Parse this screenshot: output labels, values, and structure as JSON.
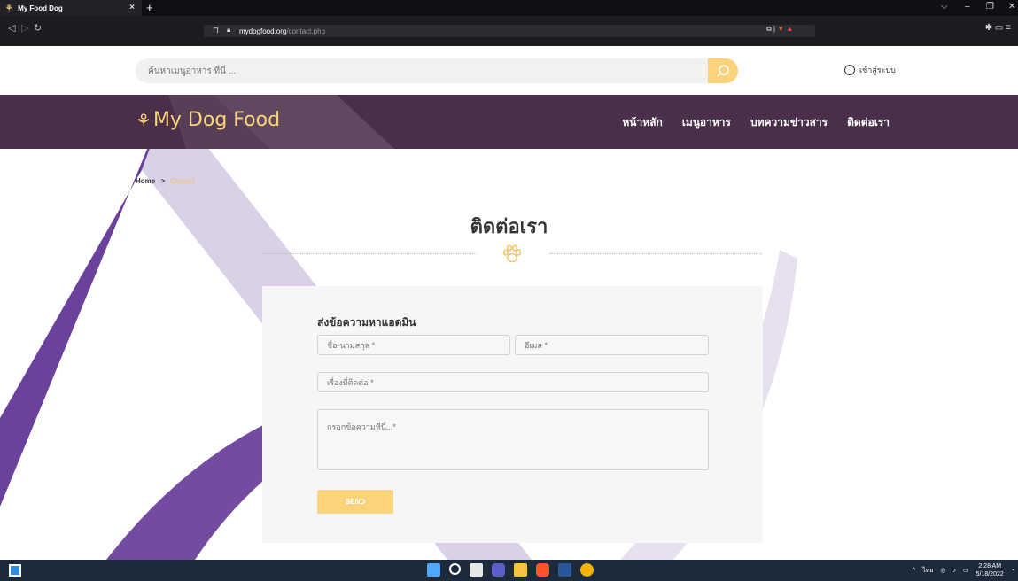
{
  "browser": {
    "tab_title": "My Food Dog",
    "tab_close": "×",
    "new_tab": "+",
    "url_host": "mydogfood.org",
    "url_path": "/contact.php",
    "window_controls": [
      "⌵",
      "–",
      "❐",
      "✕"
    ]
  },
  "search": {
    "placeholder": "ค้นหาเมนูอาหาร ที่นี่ ..."
  },
  "login_label": "เข้าสู่ระบบ",
  "brand": {
    "name": "My Dog Food",
    "color": "#fad37a"
  },
  "nav": {
    "items": [
      "หน้าหลัก",
      "เมนูอาหาร",
      "บทความข่าวสาร",
      "ติดต่อเรา"
    ]
  },
  "breadcrumb": {
    "home": "Home",
    "separator": ">",
    "current": "Contact"
  },
  "page_title": "ติดต่อเรา",
  "form": {
    "title": "ส่งข้อความหาแอดมิน",
    "name_placeholder": "ชื่อ-นามสกุล *",
    "email_placeholder": "อีเมล *",
    "subject_placeholder": "เรื่องที่ติดต่อ *",
    "message_placeholder": "กรอกข้อความที่นี่...*",
    "send_label": "SEND"
  },
  "taskbar": {
    "time": "2:28 AM",
    "date": "5/18/2022",
    "lang": "ไทย"
  },
  "colors": {
    "header_bg": "#4a2f4a",
    "accent": "#fad37a",
    "watermark": "#5b2d90"
  }
}
